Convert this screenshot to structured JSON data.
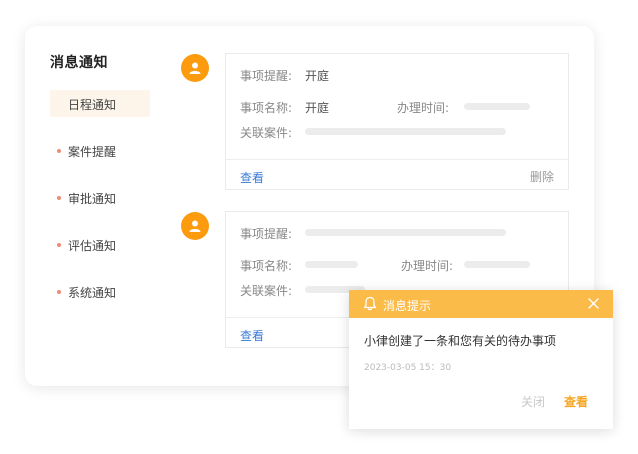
{
  "sidebar": {
    "title": "消息通知",
    "items": [
      {
        "label": "日程通知"
      },
      {
        "label": "案件提醒"
      },
      {
        "label": "审批通知"
      },
      {
        "label": "评估通知"
      },
      {
        "label": "系统通知"
      }
    ]
  },
  "messages": [
    {
      "reminder_label": "事项提醒:",
      "reminder_value": "开庭",
      "name_label": "事项名称:",
      "name_value": "开庭",
      "time_label": "办理时间:",
      "case_label": "关联案件:",
      "view_label": "查看",
      "delete_label": "删除"
    },
    {
      "reminder_label": "事项提醒:",
      "name_label": "事项名称:",
      "time_label": "办理时间:",
      "case_label": "关联案件:",
      "view_label": "查看"
    }
  ],
  "popup": {
    "title": "消息提示",
    "message": "小律创建了一条和您有关的待办事项",
    "time": "2023-03-05  15：30",
    "close_label": "关闭",
    "view_label": "查看"
  },
  "colors": {
    "accent": "#fd9b0e",
    "popup_header": "#fbbb48",
    "link": "#3a7bd5",
    "active_bg": "#fdf4ea"
  }
}
